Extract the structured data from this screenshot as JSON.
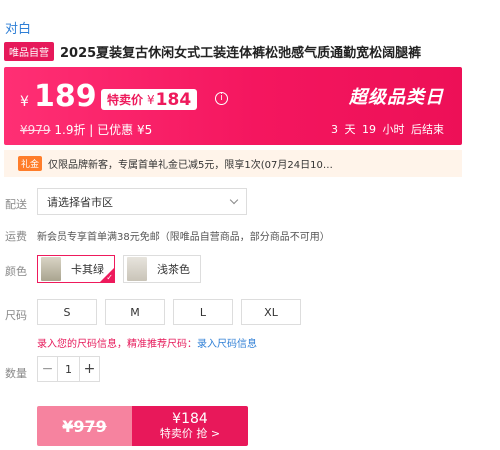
{
  "brand": "对白",
  "badge": "唯品自营",
  "title": "2025夏装复古休闲女式工装连体裤松弛感气质通勤宽松阔腿裤",
  "price": {
    "currency": "¥",
    "current": "189",
    "special_label": "特卖价",
    "special_currency": "¥",
    "special_value": "184",
    "original": "¥979",
    "discount_text": "1.9折 | 已优惠 ¥5",
    "promo_title": "超级品类日",
    "countdown": "3 天 19 小时 后结束",
    "info_icon": "info-icon"
  },
  "coupon": {
    "badge": "礼金",
    "text": "仅限品牌新客，专属首单礼金已减5元，限享1次(07月24日10…"
  },
  "delivery": {
    "label": "配送",
    "select_placeholder": "请选择省市区",
    "select_icon": "chevron-down-icon"
  },
  "shipping": {
    "label": "运费",
    "text": "新会员专享首单满38元免邮（限唯品自营商品，部分商品不可用）"
  },
  "color": {
    "label": "颜色",
    "options": [
      "卡其绿",
      "浅茶色"
    ],
    "selected": "卡其绿"
  },
  "size": {
    "label": "尺码",
    "options": [
      "S",
      "M",
      "L",
      "XL"
    ],
    "note_pink": "录入您的尺码信息，精准推荐尺码：",
    "note_link": "录入尺码信息"
  },
  "quantity": {
    "label": "数量",
    "value": "1",
    "minus": "−",
    "plus": "+"
  },
  "buy": {
    "original": "¥979",
    "price": "¥184",
    "label": "特卖价 抢 >"
  },
  "colors": {
    "accent": "#ee1a5c",
    "link": "#2f7fd6",
    "coupon_bg": "#fff4ea",
    "buy_light": "#f6839f"
  }
}
